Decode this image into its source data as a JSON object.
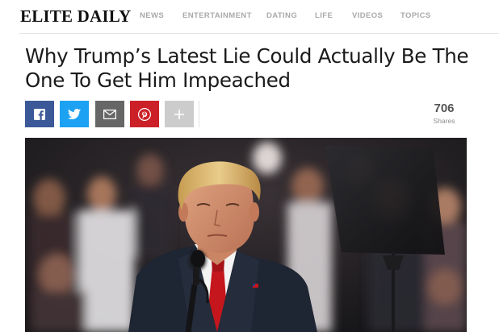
{
  "site": {
    "logo": "ELITE DAILY",
    "nav": [
      "NEWS",
      "ENTERTAINMENT",
      "DATING",
      "LIFE",
      "VIDEOS",
      "TOPICS"
    ]
  },
  "article": {
    "title": "Why Trump’s Latest Lie Could Actually Be The One To Get Him Impeached"
  },
  "share": {
    "buttons": [
      {
        "name": "facebook",
        "icon": "facebook-icon",
        "color": "#3b5998"
      },
      {
        "name": "twitter",
        "icon": "twitter-icon",
        "color": "#1da1f2"
      },
      {
        "name": "email",
        "icon": "mail-icon",
        "color": "#666666"
      },
      {
        "name": "pinterest",
        "icon": "pinterest-icon",
        "color": "#cb2027"
      },
      {
        "name": "more",
        "icon": "plus-icon",
        "color": "#cccccc"
      }
    ],
    "count": "706",
    "count_label": "Shares"
  },
  "hero_image": {
    "subject": "photo"
  }
}
